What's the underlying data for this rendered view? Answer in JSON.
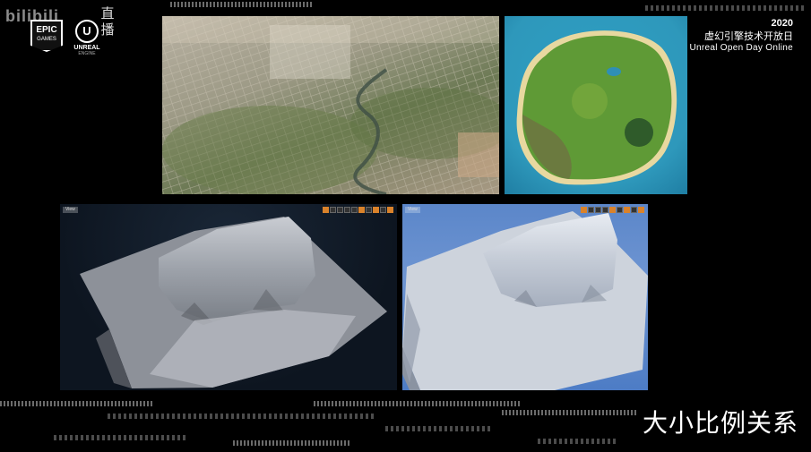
{
  "watermark": {
    "text": "bilibili",
    "live_label": "直播"
  },
  "logos": {
    "epic_line1": "EPIC",
    "epic_line2": "GAMES",
    "unreal_mark": "U",
    "unreal_line1": "UNREAL",
    "unreal_line2": "ENGINE"
  },
  "event": {
    "year": "2020",
    "title_cn": "虚幻引擎技术开放日",
    "title_en": "Unreal Open Day Online"
  },
  "viewports": {
    "left_tab": "View",
    "right_tab": "View"
  },
  "caption": "大小比例关系",
  "colors": {
    "accent_orange": "#d9822b",
    "sky_blue": "#5b86c9",
    "ocean": "#2f9fc4"
  }
}
